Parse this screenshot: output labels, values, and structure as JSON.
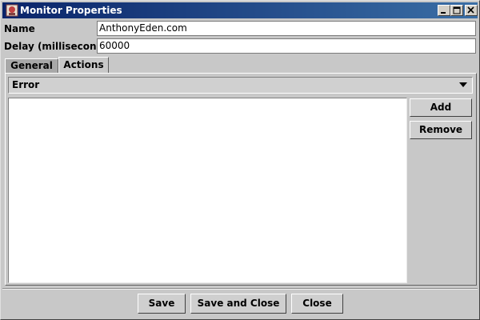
{
  "window": {
    "title": "Monitor Properties",
    "titlebar_color": "#0a246a"
  },
  "form": {
    "name_label": "Name",
    "name_value": "AnthonyEden.com",
    "delay_label": "Delay (milliseconds)",
    "delay_value": "60000"
  },
  "tabs": [
    {
      "label": "General",
      "selected": false
    },
    {
      "label": "Actions",
      "selected": true
    }
  ],
  "actions_panel": {
    "selected_type": "Error",
    "items": [],
    "add_label": "Add",
    "remove_label": "Remove"
  },
  "footer": {
    "save_label": "Save",
    "save_close_label": "Save and Close",
    "close_label": "Close"
  },
  "icons": {
    "app": "app-icon",
    "minimize": "minimize-icon",
    "maximize": "maximize-icon",
    "close": "close-icon",
    "dropdown": "chevron-down-icon"
  }
}
